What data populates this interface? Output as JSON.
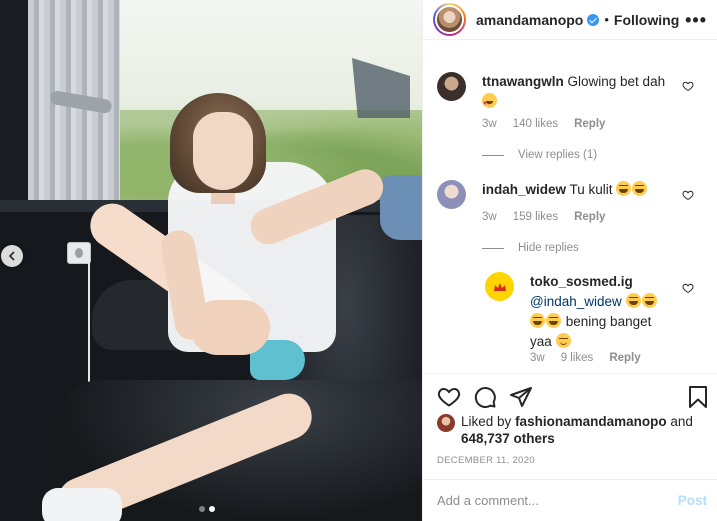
{
  "post": {
    "author": "amandamanopo",
    "separator": "•",
    "follow_status": "Following",
    "more_label": "•••"
  },
  "comments": [
    {
      "username": "ttnawangwln",
      "text": "Glowing bet dah",
      "emoji": "smiling-face-with-heart-eyes",
      "age": "3w",
      "likes": "140 likes",
      "reply_label": "Reply",
      "thread_toggle": "View replies (1)"
    },
    {
      "username": "indah_widew",
      "text": "Tu kulit",
      "emoji": "face-with-tears-of-joy",
      "age": "3w",
      "likes": "159 likes",
      "reply_label": "Reply",
      "thread_toggle": "Hide replies"
    }
  ],
  "reply": {
    "username": "toko_sosmed.ig",
    "mention": "@indah_widew",
    "text_line": "bening banget",
    "text_tail": "yaa",
    "emoji": "face-with-tears-of-joy",
    "age": "3w",
    "likes": "9 likes",
    "reply_label": "Reply"
  },
  "actions": {
    "like_icon": "heart-outline-icon",
    "comment_icon": "comment-bubble-icon",
    "share_icon": "paper-plane-icon",
    "save_icon": "bookmark-icon"
  },
  "likes_summary": {
    "prefix": "Liked by",
    "user": "fashionamandamanopo",
    "conjunction": "and",
    "others": "648,737 others"
  },
  "date": "DECEMBER 11, 2020",
  "composer": {
    "placeholder": "Add a comment...",
    "post_label": "Post"
  },
  "carousel": {
    "total_slides": 2,
    "current_slide": 2
  },
  "colors": {
    "verified": "#3897f0",
    "post_button_disabled": "#b2dffc",
    "muted_text": "#8e8e8e"
  }
}
